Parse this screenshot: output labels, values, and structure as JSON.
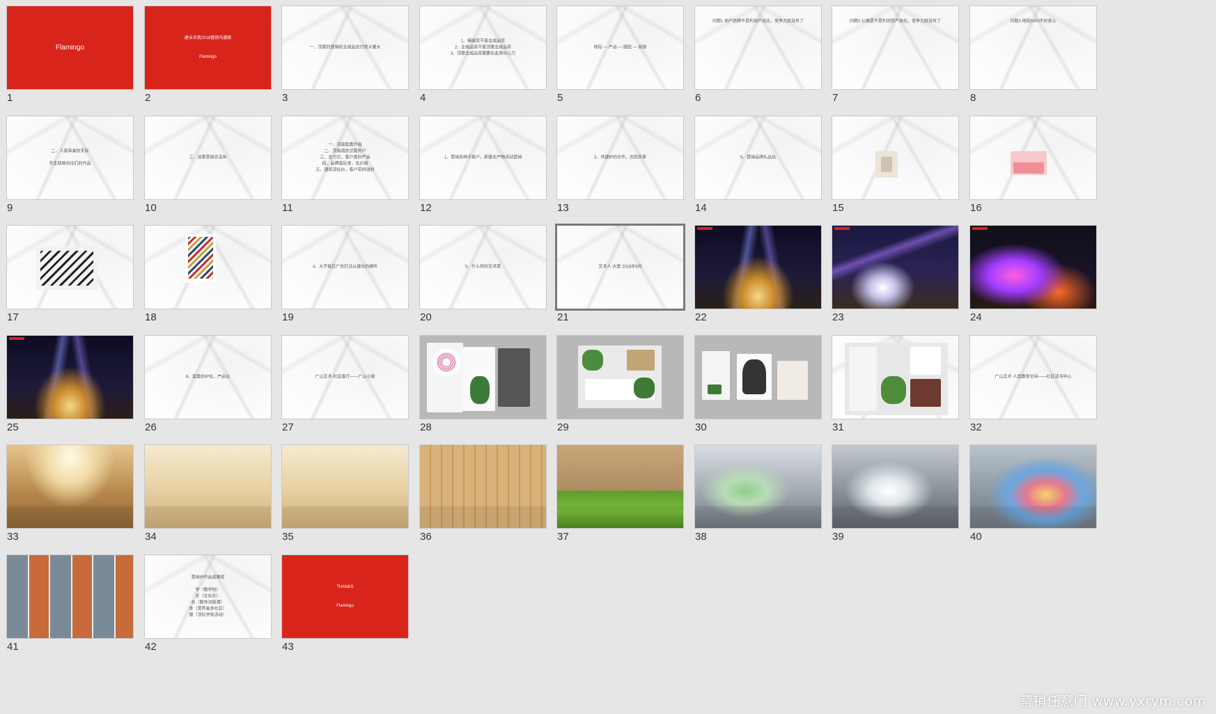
{
  "slides": [
    {
      "num": "1",
      "bg": "red",
      "text": "Flamingo",
      "tx": "big"
    },
    {
      "num": "2",
      "bg": "red",
      "text": "建业天筑2018营销沟通案\n\n\nFlamingo",
      "tx": ""
    },
    {
      "num": "3",
      "bg": "marble",
      "text": "一、顶豪的营销权全成品交付意义重大",
      "tx": ""
    },
    {
      "num": "4",
      "bg": "marble",
      "text": "1、精装房不是全成品房\n2、全成品房不是顶豪全成品房\n3、顶豪全成品房需要在此用尽心力",
      "tx": ""
    },
    {
      "num": "5",
      "bg": "marble",
      "text": "地段 — 产品 — 圈层 — 前景",
      "tx": ""
    },
    {
      "num": "6",
      "bg": "marble",
      "text": "问题1 地产品牌不是利润产品化，竞争力就没有了",
      "tx": "top"
    },
    {
      "num": "7",
      "bg": "marble",
      "text": "问题2 公寓是不是利润型产品化，竞争力就没有了",
      "tx": "top"
    },
    {
      "num": "8",
      "bg": "marble",
      "text": "问题3 地段5000不好卖么",
      "tx": "top"
    },
    {
      "num": "9",
      "bg": "marble",
      "text": "二、人是审美的天际\n\n天生就格向往们的作品",
      "tx": ""
    },
    {
      "num": "10",
      "bg": "marble",
      "text": "三、该豪营销且没有",
      "tx": ""
    },
    {
      "num": "11",
      "bg": "marble",
      "text": "一、顶级配置升级\n二、顶级酒店式服务户\n三、全方位，客户类的产品\n四、品牌高标准，化价格\n五、建筑顶标价，客户带的钱的",
      "tx": ""
    },
    {
      "num": "12",
      "bg": "marble",
      "text": "1、营销各种子客户，即建业产物活动营销",
      "tx": ""
    },
    {
      "num": "13",
      "bg": "marble",
      "text": "3、共建IP的合作，志权共享",
      "tx": ""
    },
    {
      "num": "14",
      "bg": "marble",
      "text": "5、营销品牌礼品化",
      "tx": ""
    },
    {
      "num": "15",
      "bg": "marble",
      "text": "",
      "tx": "top"
    },
    {
      "num": "16",
      "bg": "marble",
      "text": "",
      "tx": "top"
    },
    {
      "num": "17",
      "bg": "marble",
      "text": "",
      "tx": "top"
    },
    {
      "num": "18",
      "bg": "marble",
      "text": "",
      "tx": ""
    },
    {
      "num": "19",
      "bg": "marble",
      "text": "4、大节假日广告打过从建化的硬件",
      "tx": ""
    },
    {
      "num": "20",
      "bg": "marble",
      "text": "5、什么样的艺术家",
      "tx": ""
    },
    {
      "num": "21",
      "bg": "marble",
      "text": "艺术人·大爱 2018年6月",
      "tx": "",
      "selected": true
    },
    {
      "num": "22",
      "bg": "night",
      "text": "",
      "tag": true
    },
    {
      "num": "23",
      "bg": "night2",
      "text": "",
      "tag": true
    },
    {
      "num": "24",
      "bg": "neon",
      "text": "",
      "tag": true
    },
    {
      "num": "25",
      "bg": "night",
      "text": "",
      "tag": true
    },
    {
      "num": "26",
      "bg": "marble",
      "text": "6、配套的IP化，产品化",
      "tx": ""
    },
    {
      "num": "27",
      "bg": "marble",
      "text": "广山艺术·社区客厅——广山小厨",
      "tx": ""
    },
    {
      "num": "28",
      "bg": "gray",
      "text": "",
      "items": "brand1"
    },
    {
      "num": "29",
      "bg": "gray",
      "text": "",
      "items": "brand2"
    },
    {
      "num": "30",
      "bg": "gray",
      "text": "",
      "items": "brand3"
    },
    {
      "num": "31",
      "bg": "marble",
      "text": "",
      "items": "brand4"
    },
    {
      "num": "32",
      "bg": "marble",
      "text": "广山艺术·人居教育空间——社区读书中心",
      "tx": ""
    },
    {
      "num": "33",
      "bg": "lib-warm",
      "text": ""
    },
    {
      "num": "34",
      "bg": "lib-light",
      "text": ""
    },
    {
      "num": "35",
      "bg": "lib-light",
      "text": ""
    },
    {
      "num": "36",
      "bg": "lib-wood",
      "text": ""
    },
    {
      "num": "37",
      "bg": "lib-green",
      "text": ""
    },
    {
      "num": "38",
      "bg": "hall",
      "text": ""
    },
    {
      "num": "39",
      "bg": "hall2",
      "text": ""
    },
    {
      "num": "40",
      "bg": "hall3",
      "text": ""
    },
    {
      "num": "41",
      "bg": "collage",
      "text": ""
    },
    {
      "num": "42",
      "bg": "marble",
      "text": "营销IP作品成果呢\n\n学（教学校）\n乐（文化乐）\n衣（服饰流程潮）\n食（营养美食社区）\n健（顶标学院活动）",
      "tx": ""
    },
    {
      "num": "43",
      "bg": "red",
      "text": "THANKS\n\n\nFlamingo",
      "tx": ""
    }
  ],
  "watermark": "营销任意门 www.yxrym.com",
  "colors": {
    "background": "#e6e6e6",
    "red": "#d9241c"
  }
}
